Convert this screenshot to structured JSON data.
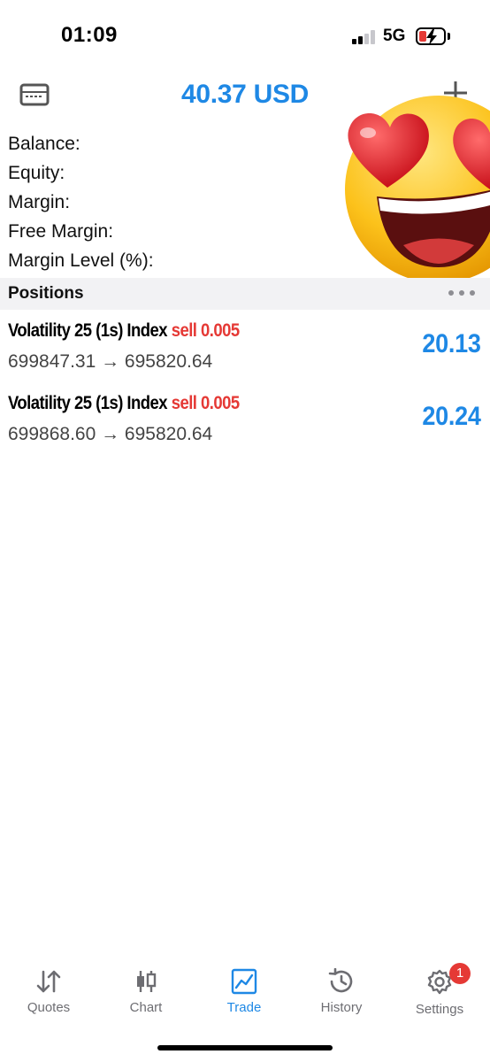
{
  "status_bar": {
    "time": "01:09",
    "network": "5G"
  },
  "header": {
    "balance_title": "40.37 USD"
  },
  "account": {
    "balance_label": "Balance:",
    "equity_label": "Equity:",
    "margin_label": "Margin:",
    "free_margin_label": "Free Margin:",
    "margin_level_label": "Margin Level (%):"
  },
  "positions": {
    "title": "Positions",
    "items": [
      {
        "symbol": "Volatility 25 (1s) Index",
        "side": "sell 0.005",
        "prices": "699847.31 → 695820.64",
        "profit": "20.13"
      },
      {
        "symbol": "Volatility 25 (1s) Index",
        "side": "sell 0.005",
        "prices": "699868.60 → 695820.64",
        "profit": "20.24"
      }
    ]
  },
  "tabs": {
    "quotes": "Quotes",
    "chart": "Chart",
    "trade": "Trade",
    "history": "History",
    "settings": "Settings",
    "settings_badge": "1",
    "active": "Trade"
  },
  "colors": {
    "accent": "#1e88e5",
    "sell": "#e53935",
    "badge": "#e53935"
  },
  "icons": {
    "wallet": "wallet-icon",
    "plus": "plus-icon",
    "more": "more-icon",
    "quotes": "arrows-updown-icon",
    "chart": "candlestick-icon",
    "trade": "trend-chart-icon",
    "history": "history-clock-icon",
    "settings": "gear-icon",
    "emoji": "heart-eyes-emoji"
  }
}
